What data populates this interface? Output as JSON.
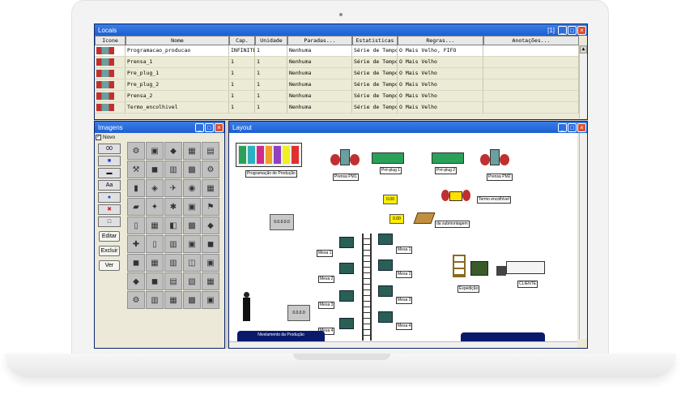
{
  "locais": {
    "title": "Locais",
    "counter": "[1]",
    "columns": [
      "Icone",
      "Nome",
      "Cap.",
      "Unidade",
      "Paradas...",
      "Estatisticas",
      "Regras...",
      "Anotações..."
    ],
    "rows": [
      {
        "nome": "Programacao_producao",
        "cap": "INFINITE",
        "unidade": "1",
        "paradas": "Nenhuma",
        "estat": "Série de Tempo",
        "regras": "O Mais Velho, FIFO"
      },
      {
        "nome": "Prensa_1",
        "cap": "1",
        "unidade": "1",
        "paradas": "Nenhuma",
        "estat": "Série de Tempo",
        "regras": "O Mais Velho"
      },
      {
        "nome": "Pre_plug_1",
        "cap": "1",
        "unidade": "1",
        "paradas": "Nenhuma",
        "estat": "Série de Tempo",
        "regras": "O Mais Velho"
      },
      {
        "nome": "Pre_plug_2",
        "cap": "1",
        "unidade": "1",
        "paradas": "Nenhuma",
        "estat": "Série de Tempo",
        "regras": "O Mais Velho"
      },
      {
        "nome": "Prensa_2",
        "cap": "1",
        "unidade": "1",
        "paradas": "Nenhuma",
        "estat": "Série de Tempo",
        "regras": "O Mais Velho"
      },
      {
        "nome": "Termo_encolhivel",
        "cap": "1",
        "unidade": "1",
        "paradas": "Nenhuma",
        "estat": "Série de Tempo",
        "regras": "O Mais Velho"
      }
    ]
  },
  "imagens": {
    "title": "Imagens",
    "novo_label": "Novo",
    "tools": [
      "00",
      "■",
      "▬",
      "Aa",
      "●",
      "✖",
      "□"
    ],
    "buttons": [
      "Editar",
      "Excluir",
      "Ver"
    ]
  },
  "layout": {
    "title": "Layout",
    "labels": {
      "programacao": "Programação de Produção",
      "prensa1": "Prensa PM1",
      "preplug1": "Pré-plug 1",
      "preplug2": "Pré-plug 2",
      "prensa2": "Prensa PM2",
      "termo": "Termo encolhível",
      "submontagem": "da submontagem",
      "mesa1l": "Mesa 1",
      "mesa2l": "Mesa 2",
      "mesa3l": "Mesa 3",
      "mesa4l": "Mesa 4",
      "mesa1r": "Mesa 1",
      "mesa2r": "Mesa 2",
      "mesa3r": "Mesa 3",
      "mesa4r": "Mesa 4",
      "expedicao": "Expedição",
      "cliente": "CLIENTE",
      "nivelamento": "Nivelamento da Produção"
    },
    "boxes": {
      "y1": "0.00",
      "y2": "0.00",
      "g1": "0.0.0.0.0",
      "g2": "0.0.0.0"
    }
  },
  "colors": {
    "titlebar": "#1c5fd2",
    "canvas": "#ffffff",
    "table_bg": "#ebebd6"
  }
}
